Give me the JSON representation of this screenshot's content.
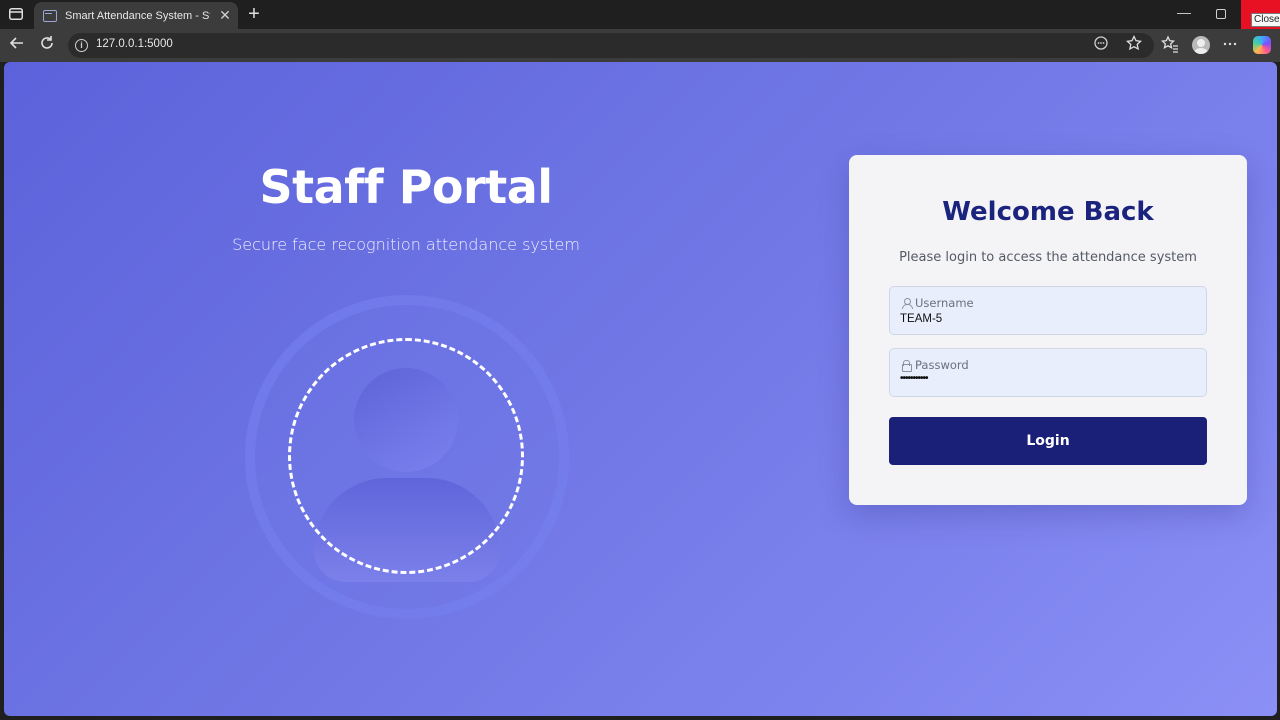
{
  "browser": {
    "tab_title": "Smart Attendance System - Staff Portal",
    "close_tooltip": "Close",
    "url": "127.0.0.1:5000"
  },
  "hero": {
    "title": "Staff Portal",
    "subtitle": "Secure face recognition attendance system"
  },
  "login": {
    "title": "Welcome Back",
    "subtitle": "Please login to access the attendance system",
    "username_label": "Username",
    "username_value": "TEAM-5",
    "password_label": "Password",
    "password_value": "•••••••••••",
    "button_label": "Login"
  },
  "colors": {
    "accent": "#1a237e",
    "button": "#1a1f78",
    "page_bg_start": "#5c62db",
    "page_bg_end": "#8b90f6"
  }
}
